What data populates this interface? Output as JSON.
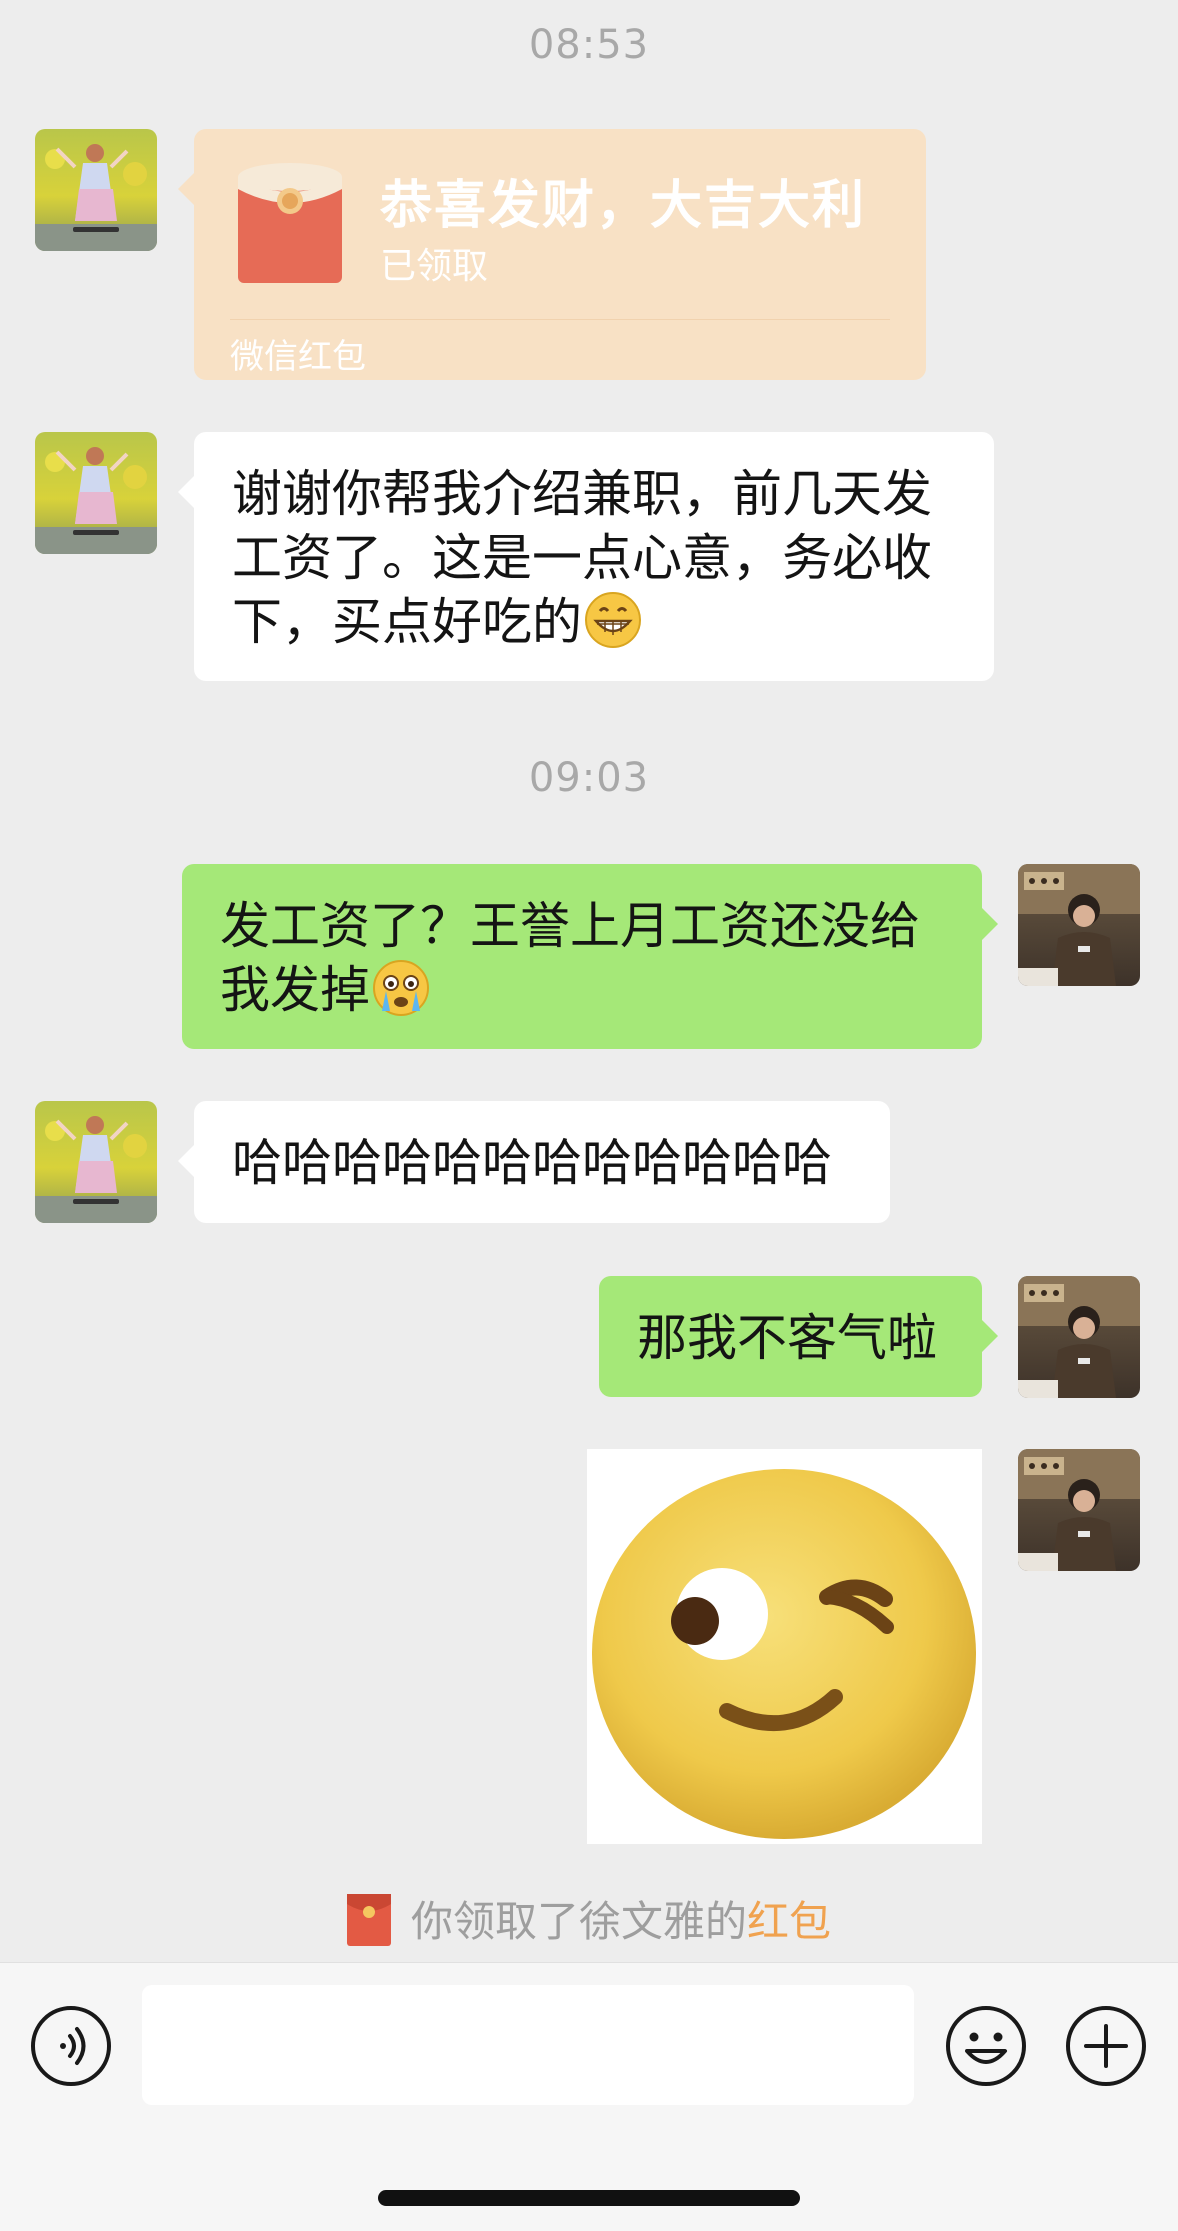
{
  "timestamps": {
    "first": "08:53",
    "second": "09:03"
  },
  "red_packet": {
    "title": "恭喜发财，大吉大利",
    "status": "已领取",
    "footer": "微信红包"
  },
  "messages": {
    "thanks": {
      "text": "谢谢你帮我介绍兼职，前几天发工资了。这是一点心意，务必收下，买点好吃的",
      "emoji": "grinning-emoji"
    },
    "salary_reply": {
      "text": "发工资了？王誉上月工资还没给我发掉",
      "emoji": "crying-emoji"
    },
    "laugh": {
      "text": "哈哈哈哈哈哈哈哈哈哈哈哈"
    },
    "accept": {
      "text": "那我不客气啦"
    },
    "sticker": {
      "icon": "wink-sticker"
    }
  },
  "notice": {
    "prefix": "你领取了徐文雅的",
    "link": "红包",
    "icon": "red-packet-icon"
  },
  "input_bar": {
    "voice_icon": "voice-icon",
    "emoji_icon": "emoji-icon",
    "plus_icon": "plus-icon",
    "placeholder": ""
  },
  "colors": {
    "background": "#ededed",
    "green_bubble": "#a5e878",
    "red_packet_bg": "#f8e1c5",
    "link": "#f0a24f"
  }
}
